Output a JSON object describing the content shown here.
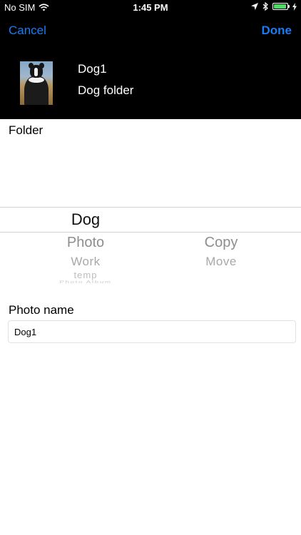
{
  "status_bar": {
    "carrier": "No SIM",
    "time": "1:45 PM",
    "battery_level": 0.95,
    "battery_color": "#4cd964"
  },
  "nav": {
    "cancel_label": "Cancel",
    "done_label": "Done",
    "accent_color": "#1a7cf2"
  },
  "photo": {
    "name": "Dog1",
    "folder": "Dog folder"
  },
  "folder_section": {
    "label": "Folder"
  },
  "picker": {
    "folder_column": {
      "selected": "Dog",
      "below": [
        "Photo",
        "Work",
        "temp",
        "Photo Album"
      ]
    },
    "action_column": {
      "selected": "",
      "below": [
        "Copy",
        "Move"
      ]
    }
  },
  "photo_name_section": {
    "label": "Photo name",
    "value": "Dog1"
  }
}
